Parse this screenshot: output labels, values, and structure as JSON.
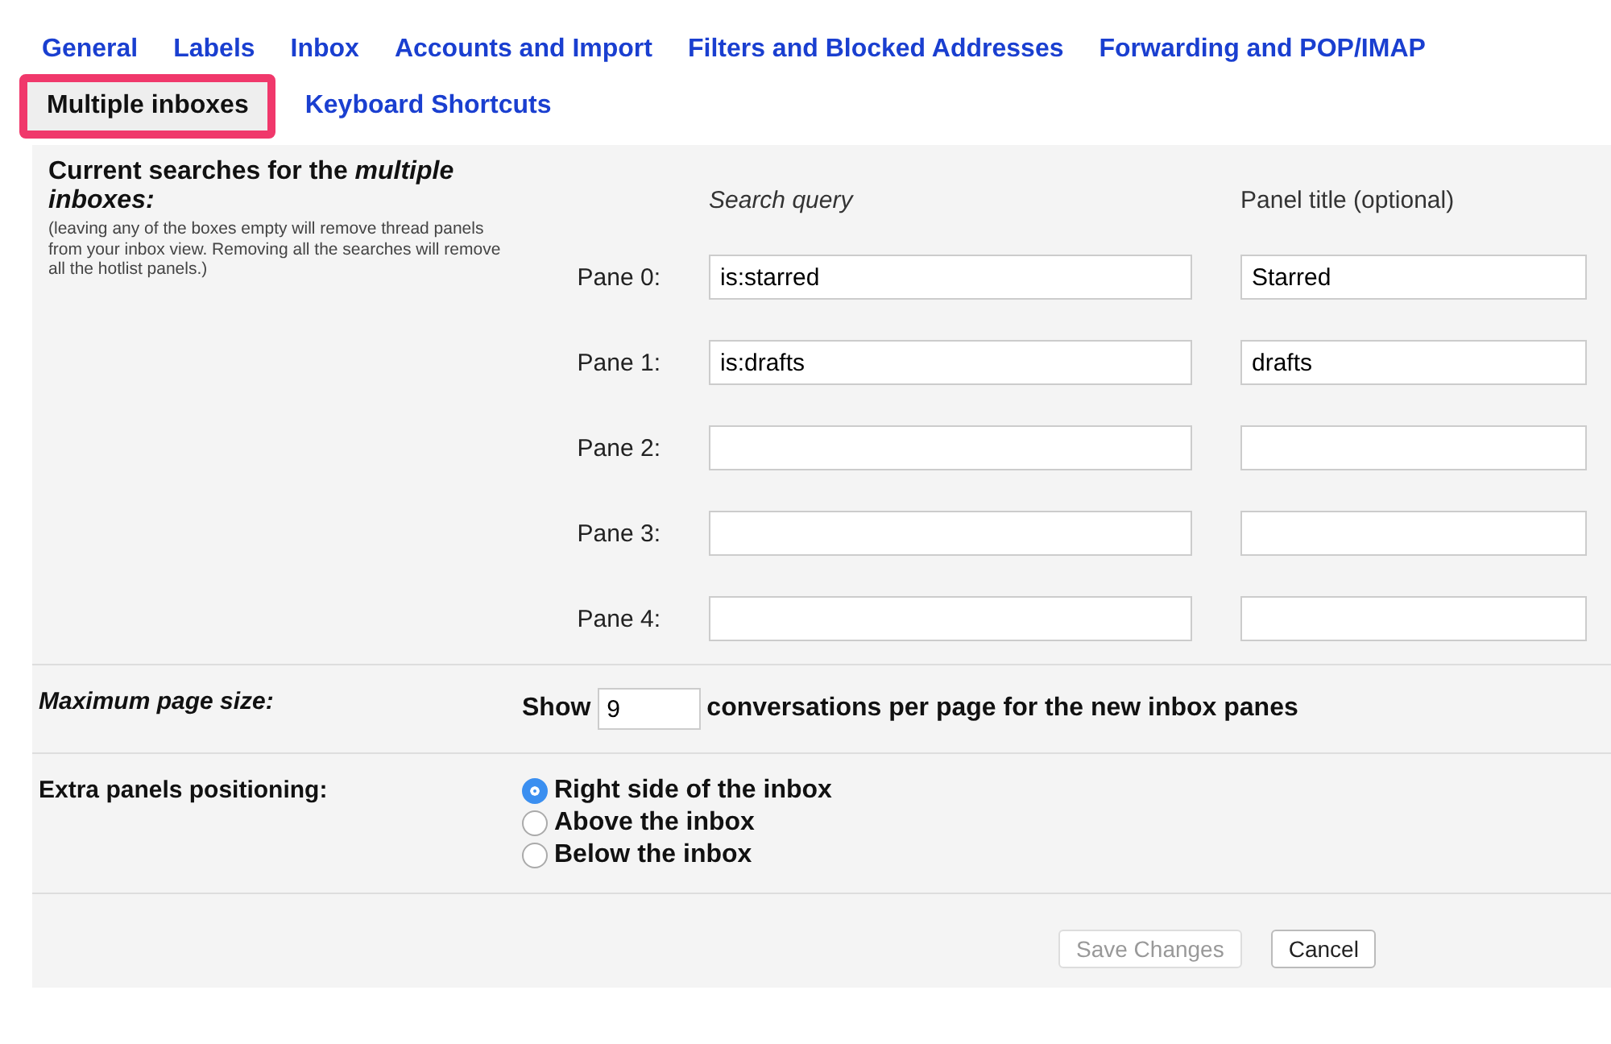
{
  "tabs": [
    {
      "label": "General",
      "selected": false
    },
    {
      "label": "Labels",
      "selected": false
    },
    {
      "label": "Inbox",
      "selected": false
    },
    {
      "label": "Accounts and Import",
      "selected": false
    },
    {
      "label": "Filters and Blocked Addresses",
      "selected": false
    },
    {
      "label": "Forwarding and POP/IMAP",
      "selected": false
    },
    {
      "label": "Multiple inboxes",
      "selected": true
    },
    {
      "label": "Keyboard Shortcuts",
      "selected": false
    }
  ],
  "searches": {
    "title": "Current searches for the *multiple inboxes:*",
    "note": "(leaving any of the boxes empty will remove thread panels from your inbox view. Removing all the searches will remove all the hotlist panels.)",
    "query_heading": "Search query",
    "title_heading": "Panel title (optional)",
    "panes": [
      {
        "label": "Pane 0:",
        "query": "is:starred",
        "panel_title": "Starred"
      },
      {
        "label": "Pane 1:",
        "query": "is:drafts",
        "panel_title": "drafts"
      },
      {
        "label": "Pane 2:"
      },
      {
        "label": "Pane 3:"
      },
      {
        "label": "Pane 4:"
      }
    ]
  },
  "page_size": {
    "label": "Maximum page size:",
    "before": "Show",
    "value": "9",
    "after": "conversations per page for the new inbox panes"
  },
  "positioning": {
    "label": "Extra panels positioning:",
    "options": [
      {
        "label": "Right side of the inbox",
        "selected": true
      },
      {
        "label": "Above the inbox",
        "selected": false
      },
      {
        "label": "Below the inbox",
        "selected": false
      }
    ]
  },
  "buttons": [
    {
      "label": "Save Changes",
      "disabled": true
    },
    {
      "label": "Cancel",
      "disabled": false
    }
  ]
}
